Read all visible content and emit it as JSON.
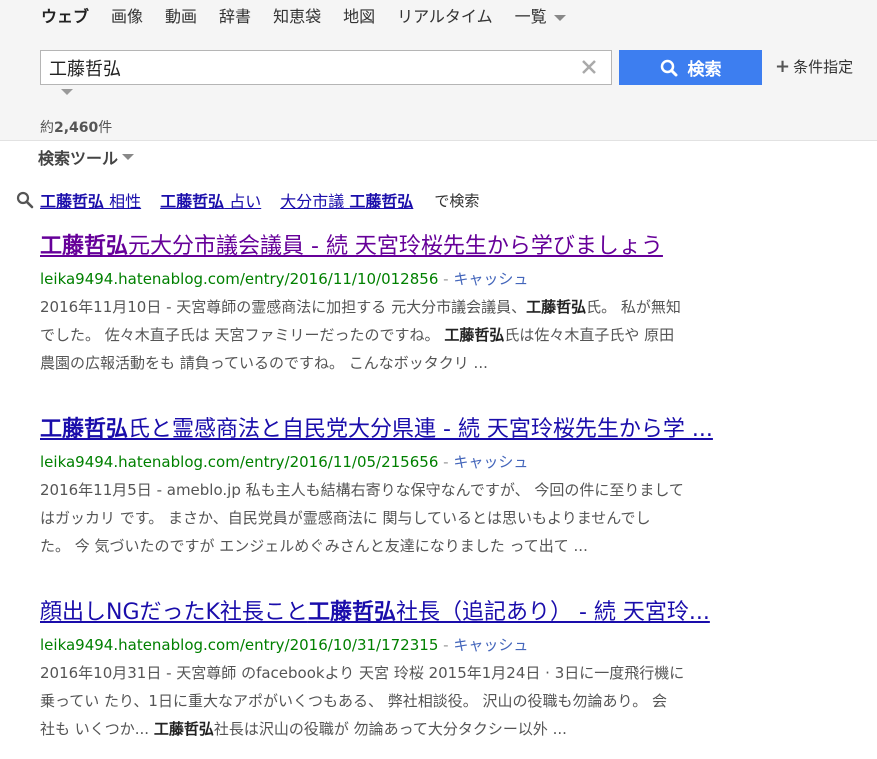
{
  "nav": {
    "tabs": [
      "ウェブ",
      "画像",
      "動画",
      "辞書",
      "知恵袋",
      "地図",
      "リアルタイム",
      "一覧"
    ]
  },
  "search": {
    "query": "工藤哲弘",
    "button_label": "検索",
    "advanced_label": "条件指定"
  },
  "result_count": {
    "prefix": "約",
    "number": "2,460",
    "suffix": "件"
  },
  "search_tools_label": "検索ツール",
  "related": {
    "items": [
      {
        "bold": "工藤哲弘",
        "rest": " 相性"
      },
      {
        "bold": "工藤哲弘",
        "rest": " 占い"
      },
      {
        "pre": "大分市議 ",
        "bold": "工藤哲弘"
      }
    ],
    "suffix": "で検索"
  },
  "results": [
    {
      "title_bold": "工藤哲弘",
      "title_rest": "元大分市議会議員 - 続 天宮玲桜先生から学びましょう",
      "url": "leika9494.hatenablog.com/entry/2016/11/10/012856",
      "sep": " - ",
      "cache": "キャッシュ",
      "snippet_lines": [
        [
          {
            "t": "2016年11月10日 - 天宮尊師の霊感商法に加担する 元大分市議会議員、"
          },
          {
            "b": "工藤哲弘"
          },
          {
            "t": "氏。 私が無知"
          }
        ],
        [
          {
            "t": "でした。 佐々木直子氏は 天宮ファミリーだったのですね。 "
          },
          {
            "b": "工藤哲弘"
          },
          {
            "t": "氏は佐々木直子氏や 原田"
          }
        ],
        [
          {
            "t": "農園の広報活動をも 請負っているのですね。 こんなボッタクリ ..."
          }
        ]
      ]
    },
    {
      "title_bold": "工藤哲弘",
      "title_rest": "氏と霊感商法と自民党大分県連 - 続 天宮玲桜先生から学 ...",
      "url": "leika9494.hatenablog.com/entry/2016/11/05/215656",
      "sep": " - ",
      "cache": "キャッシュ",
      "snippet_lines": [
        [
          {
            "t": "2016年11月5日 - ameblo.jp 私も主人も結構右寄りな保守なんですが、 今回の件に至りまして"
          }
        ],
        [
          {
            "t": "はガッカリ です。 まさか、自民党員が霊感商法に 関与しているとは思いもよりませんでし"
          }
        ],
        [
          {
            "t": "た。 今 気づいたのですが エンジェルめぐみさんと友達になりました って出て ..."
          }
        ]
      ]
    },
    {
      "title_pre": "顔出しNGだったK社長こと",
      "title_bold": "工藤哲弘",
      "title_rest": "社長（追記あり） - 続 天宮玲...",
      "url": "leika9494.hatenablog.com/entry/2016/10/31/172315",
      "sep": " - ",
      "cache": "キャッシュ",
      "snippet_lines": [
        [
          {
            "t": "2016年10月31日 - 天宮尊師 のfacebookより 天宮 玲桜 2015年1月24日 · 3日に一度飛行機に"
          }
        ],
        [
          {
            "t": "乗ってい たり、1日に重大なアポがいくつもある、 弊社相談役。 沢山の役職も勿論あり。 会"
          }
        ],
        [
          {
            "t": "社も いくつか... "
          },
          {
            "b": "工藤哲弘"
          },
          {
            "t": "社長は沢山の役職が 勿論あって大分タクシー以外 ..."
          }
        ]
      ]
    }
  ]
}
